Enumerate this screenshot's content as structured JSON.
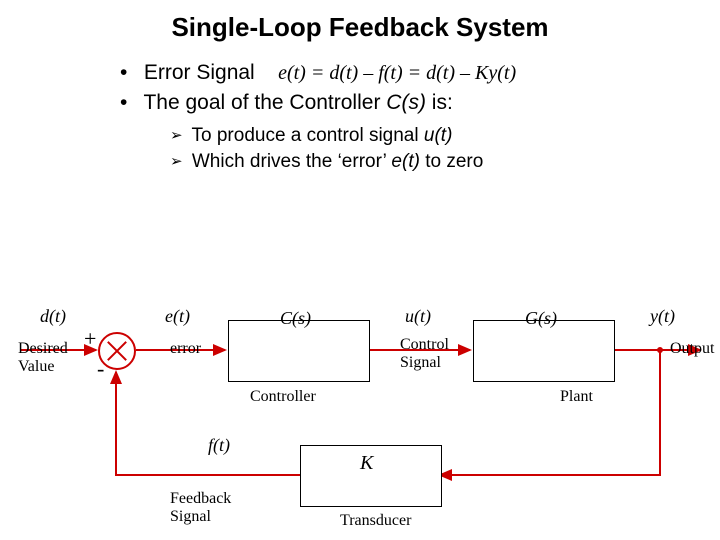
{
  "title": "Single-Loop Feedback System",
  "bullets": {
    "b1_prefix": "Error Signal",
    "b1_eq": "e(t) = d(t) – f(t) = d(t) – Ky(t)",
    "b2_prefix": "The goal of the Controller ",
    "b2_em": "C(s)",
    "b2_suffix": " is:"
  },
  "subbullets": {
    "s1_a": "To produce a control signal ",
    "s1_em": "u(t)",
    "s2_a": "Which drives the ‘error’ ",
    "s2_em": "e(t)",
    "s2_b": " to zero"
  },
  "diagram": {
    "dt": "d(t)",
    "et": "e(t)",
    "Cs": "C(s)",
    "ut": "u(t)",
    "Gs": "G(s)",
    "yt": "y(t)",
    "ft": "f(t)",
    "K": "K",
    "desired": "Desired\nValue",
    "error": "error",
    "controller": "Controller",
    "control_signal": "Control\nSignal",
    "plant": "Plant",
    "output": "Output",
    "feedback": "Feedback\nSignal",
    "transducer": "Transducer",
    "plus": "+",
    "minus": "-"
  }
}
